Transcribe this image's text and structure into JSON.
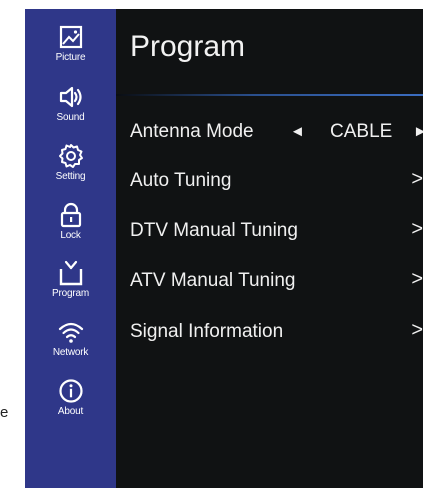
{
  "stray_text": "e",
  "sidebar": {
    "items": [
      {
        "label": "Picture",
        "icon": "picture-icon"
      },
      {
        "label": "Sound",
        "icon": "speaker-icon"
      },
      {
        "label": "Setting",
        "icon": "gear-icon"
      },
      {
        "label": "Lock",
        "icon": "lock-icon"
      },
      {
        "label": "Program",
        "icon": "tv-icon"
      },
      {
        "label": "Network",
        "icon": "wifi-icon"
      },
      {
        "label": "About",
        "icon": "info-icon"
      }
    ]
  },
  "panel": {
    "title": "Program",
    "rows": [
      {
        "label": "Antenna Mode",
        "value": "CABLE",
        "left_arrow": "◄",
        "right_arrow": "►"
      },
      {
        "label": "Auto Tuning",
        "chevron": ">"
      },
      {
        "label": "DTV Manual Tuning",
        "chevron": ">"
      },
      {
        "label": "ATV Manual Tuning",
        "chevron": ">"
      },
      {
        "label": "Signal Information",
        "chevron": ">"
      }
    ]
  },
  "colors": {
    "sidebar_bg": "#2f3789",
    "panel_bg": "#101213",
    "text": "#f0f0f0",
    "divider_accent": "#3b6dc1"
  }
}
